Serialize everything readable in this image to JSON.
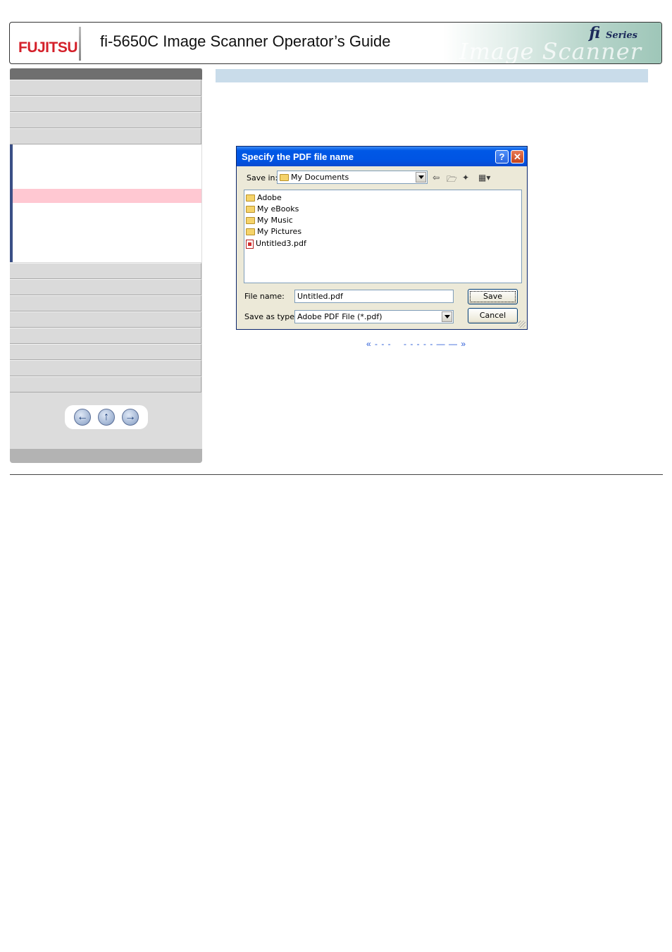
{
  "header": {
    "logo": "FUJITSU",
    "title": "fi-5650C Image Scanner Operator’s Guide",
    "brand_series": "fi Series",
    "brand_script": "Image Scanner"
  },
  "sidebar": {
    "active_color": "#ffc8d2",
    "accent_color": "#3a4f86"
  },
  "dialog": {
    "title": "Specify the PDF file name",
    "help_label": "?",
    "close_label": "✕",
    "save_in_label": "Save in:",
    "save_in_value": "My Documents",
    "files": [
      {
        "name": "Adobe",
        "icon": "folder-icon"
      },
      {
        "name": "My eBooks",
        "icon": "folder-icon"
      },
      {
        "name": "My Music",
        "icon": "music-folder-icon"
      },
      {
        "name": "My Pictures",
        "icon": "pictures-folder-icon"
      },
      {
        "name": "Untitled3.pdf",
        "icon": "pdf-file-icon"
      }
    ],
    "file_name_label": "File name:",
    "file_name_value": "Untitled.pdf",
    "save_as_type_label": "Save as type:",
    "save_as_type_value": "Adobe PDF File (*.pdf)",
    "save_button": "Save",
    "cancel_button": "Cancel"
  },
  "page_nav": {
    "prev_link": "« - - -",
    "next_link": "- - - - - — — »"
  }
}
